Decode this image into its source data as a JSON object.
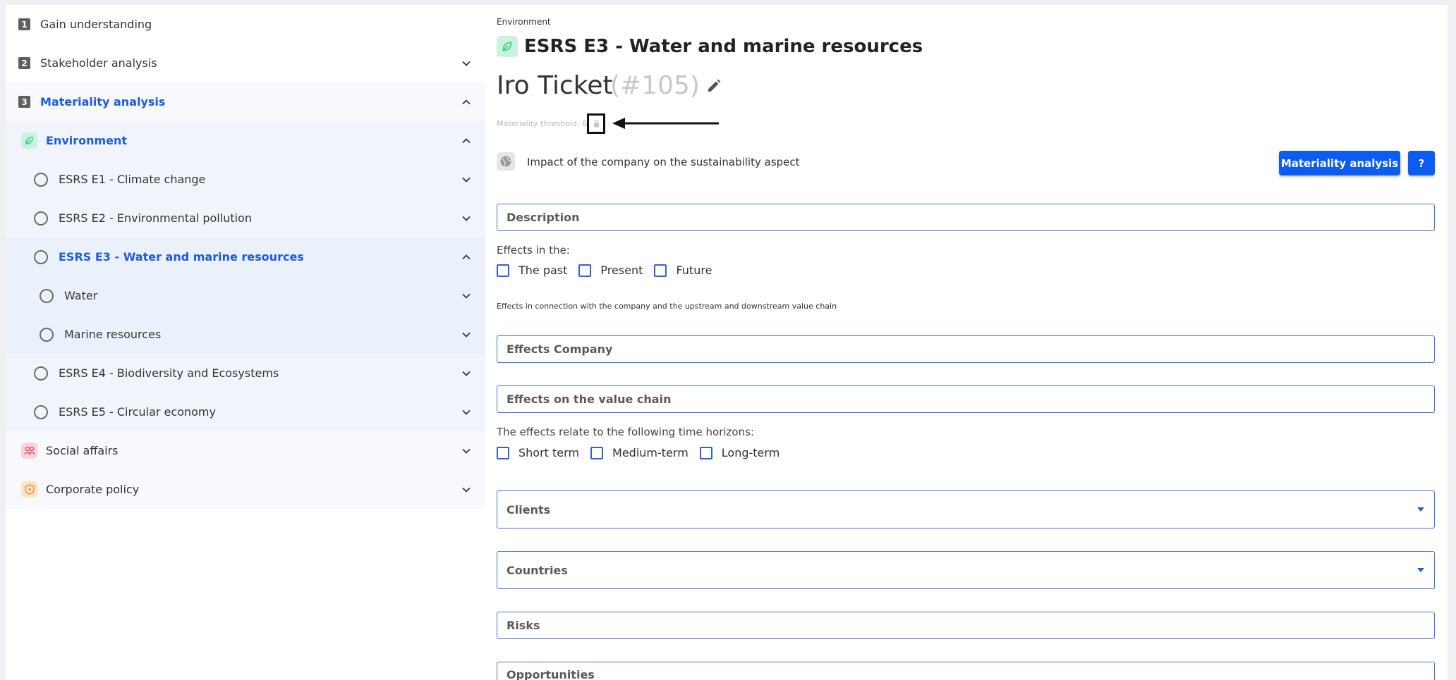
{
  "sidebar": {
    "steps": [
      {
        "num": "1",
        "label": "Gain understanding"
      },
      {
        "num": "2",
        "label": "Stakeholder analysis"
      },
      {
        "num": "3",
        "label": "Materiality analysis"
      }
    ],
    "categories": {
      "environment": "Environment",
      "social": "Social affairs",
      "corporate": "Corporate policy"
    },
    "standards": {
      "e1": "ESRS E1 - Climate change",
      "e2": "ESRS E2 - Environmental pollution",
      "e3": "ESRS E3 - Water and marine resources",
      "e4": "ESRS E4 - Biodiversity and Ecosystems",
      "e5": "ESRS E5 - Circular economy"
    },
    "topics": {
      "water": "Water",
      "marine": "Marine resources"
    }
  },
  "header": {
    "breadcrumb": "Environment",
    "title": "ESRS E3 - Water and marine resources",
    "ticket_title": "Iro Ticket",
    "ticket_number": "(#105)",
    "threshold_label": "Materiality threshold: 6"
  },
  "impact": {
    "text": "Impact of the company on the sustainability aspect",
    "materiality_button": "Materiality analysis",
    "help_button": "?"
  },
  "form": {
    "description": "Description",
    "effects_in_label": "Effects in the:",
    "effects_in_options": [
      "The past",
      "Present",
      "Future"
    ],
    "connection_note": "Effects in connection with the company and the upstream and downstream value chain",
    "effects_company": "Effects Company",
    "effects_value_chain": "Effects on the value chain",
    "horizons_label": "The effects relate to the following time horizons:",
    "horizon_options": [
      "Short term",
      "Medium-term",
      "Long-term"
    ],
    "clients": "Clients",
    "countries": "Countries",
    "risks": "Risks",
    "opportunities": "Opportunities"
  },
  "colors": {
    "accent": "#1f5be0",
    "button": "#0b5cf0",
    "environment": "#3ecf8e",
    "social": "#e84f6b",
    "corporate": "#f0963a"
  }
}
